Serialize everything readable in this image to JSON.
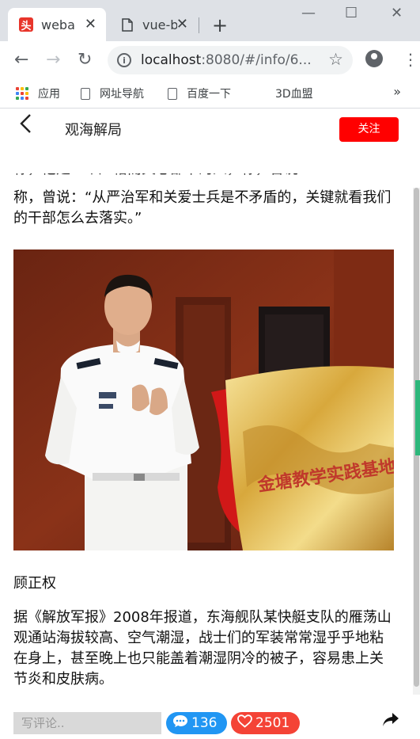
{
  "browser": {
    "tabs": [
      {
        "title": "weba",
        "favicon": "toutiao-icon",
        "active": true
      },
      {
        "title": "vue-b",
        "favicon": "document-icon",
        "active": false
      }
    ],
    "url_host": "localhost",
    "url_path": ":8080/#/info/6...",
    "bookmarks": [
      {
        "label": "应用",
        "icon": "apps-grid-icon"
      },
      {
        "label": "网址导航",
        "icon": "document-icon"
      },
      {
        "label": "百度一下",
        "icon": "document-icon"
      },
      {
        "label": "3D血盟",
        "icon": "none"
      }
    ],
    "bookmarks_more": "»"
  },
  "header": {
    "author": "观海解局",
    "follow_label": "关注"
  },
  "article": {
    "clipped_line": "称，他是一个严格而关心部下的人，称，曾说",
    "paragraph1": "称，曾说：“从严治军和关爱士兵是不矛盾的，关键就看我们的干部怎么去落实。”",
    "caption": "顾正权",
    "paragraph2": "据《解放军报》2008年报道，东海舰队某快艇支队的雁荡山观通站海拔较高、空气潮湿，战士们的军装常常湿乎乎地粘在身上，甚至晚上也只能盖着潮湿阴冷的被子，容易患上关节炎和皮肤病。",
    "photo_plaque_text": "金塘教学实践基地"
  },
  "footer": {
    "comment_placeholder": "写评论..",
    "comment_count": "136",
    "like_count": "2501"
  },
  "colors": {
    "follow": "#ff0000",
    "comments_pill": "#2196f3",
    "likes_pill": "#f44336"
  }
}
